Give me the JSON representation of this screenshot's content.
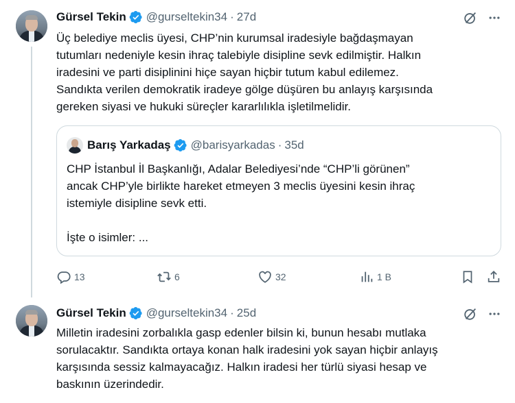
{
  "tweets": [
    {
      "name": "Gürsel Tekin",
      "handle": "@gurseltekin34",
      "separator": "·",
      "time": "27d",
      "text": "Üç belediye meclis üyesi, CHP’nin kurumsal iradesiyle bağdaşmayan\ntutumları nedeniyle kesin ihraç talebiyle disipline sevk edilmiştir. Halkın\niradesini ve parti disiplinini hiçe sayan hiçbir tutum kabul edilemez.\nSandıkta verilen demokratik iradeye gölge düşüren bu anlayış karşısında\ngereken siyasi ve hukuki süreçler kararlılıkla işletilmelidir.",
      "quote": {
        "name": "Barış Yarkadaş",
        "handle": "@barisyarkadas",
        "separator": "·",
        "time": "35d",
        "text": "CHP İstanbul İl Başkanlığı, Adalar Belediyesi’nde “CHP’li görünen”\nancak CHP’yle birlikte hareket etmeyen  3 meclis üyesini kesin ihraç\nistemiyle disipline sevk etti.\n\nİşte o isimler: ..."
      },
      "actions": {
        "replies": "13",
        "reposts": "6",
        "likes": "32",
        "views": "1 B"
      }
    },
    {
      "name": "Gürsel Tekin",
      "handle": "@gurseltekin34",
      "separator": "·",
      "time": "25d",
      "text": "Milletin iradesini zorbalıkla gasp edenler bilsin ki, bunun hesabı mutlaka\nsorulacaktır. Sandıkta ortaya konan halk iradesini yok sayan hiçbir anlayış\nkarşısında sessiz kalmayacağız. Halkın iradesi her türlü siyasi hesap ve\nbaskının üzerindedir."
    }
  ],
  "icons": {
    "verified": "verified-badge-icon",
    "grok": "grok-icon",
    "more": "more-icon",
    "reply": "reply-icon",
    "repost": "repost-icon",
    "like": "like-icon",
    "views": "views-icon",
    "bookmark": "bookmark-icon",
    "share": "share-icon"
  },
  "colors": {
    "verified": "#1d9bf0",
    "secondary_text": "#536471",
    "border": "#cfd9de"
  }
}
